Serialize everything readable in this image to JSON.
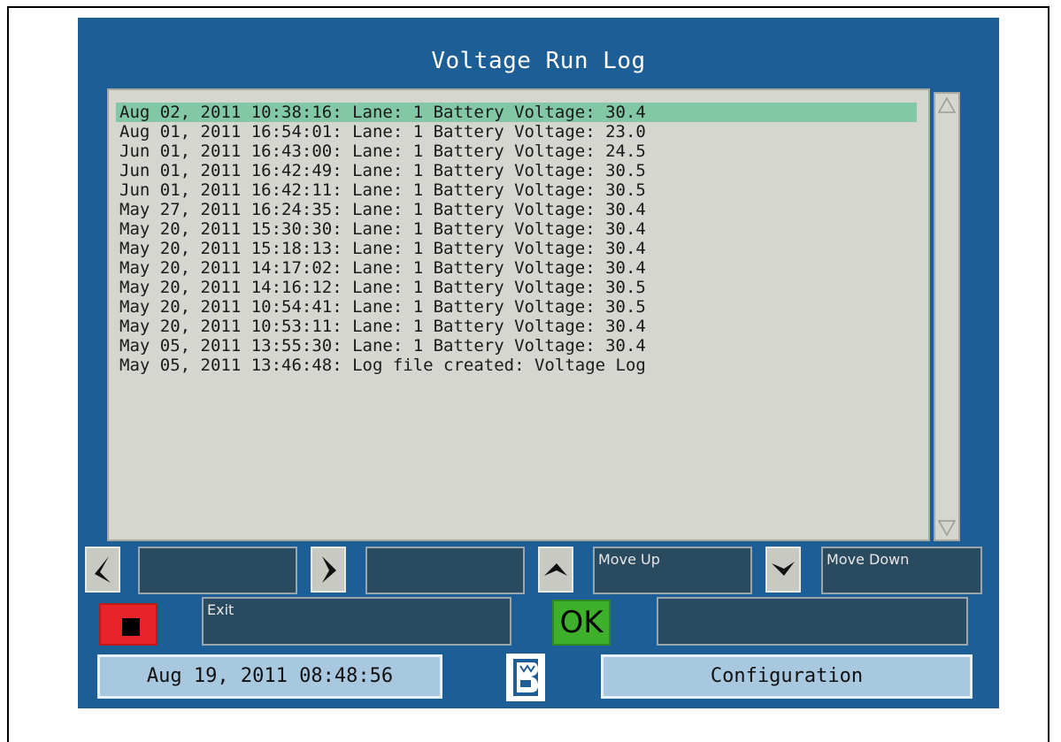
{
  "window": {
    "title": "Voltage Run Log"
  },
  "log": {
    "lines": [
      "Aug 02, 2011 10:38:16: Lane: 1 Battery Voltage: 30.4",
      "Aug 01, 2011 16:54:01: Lane: 1 Battery Voltage: 23.0",
      "Jun 01, 2011 16:43:00: Lane: 1 Battery Voltage: 24.5",
      "Jun 01, 2011 16:42:49: Lane: 1 Battery Voltage: 30.5",
      "Jun 01, 2011 16:42:11: Lane: 1 Battery Voltage: 30.5",
      "May 27, 2011 16:24:35: Lane: 1 Battery Voltage: 30.4",
      "May 20, 2011 15:30:30: Lane: 1 Battery Voltage: 30.4",
      "May 20, 2011 15:18:13: Lane: 1 Battery Voltage: 30.4",
      "May 20, 2011 14:17:02: Lane: 1 Battery Voltage: 30.4",
      "May 20, 2011 14:16:12: Lane: 1 Battery Voltage: 30.5",
      "May 20, 2011 10:54:41: Lane: 1 Battery Voltage: 30.5",
      "May 20, 2011 10:53:11: Lane: 1 Battery Voltage: 30.4",
      "May 05, 2011 13:55:30: Lane: 1 Battery Voltage: 30.4",
      "May 05, 2011 13:46:48: Log file created: Voltage Log"
    ],
    "selected_index": 0
  },
  "controls": {
    "left_label": "",
    "right_label": "",
    "move_up_label": "Move Up",
    "move_down_label": "Move Down",
    "exit_label": "Exit",
    "ok_label": "OK",
    "ok_field_label": ""
  },
  "footer": {
    "datetime": "Aug 19, 2011 08:48:56",
    "configuration_label": "Configuration"
  },
  "icons": {
    "left": "left-arrow-icon",
    "right": "right-arrow-icon",
    "up": "up-arrow-icon",
    "down": "down-arrow-icon",
    "stop": "stop-icon",
    "logo": "brand-logo-icon"
  },
  "colors": {
    "screen_bg": "#1e5e96",
    "selection": "#82c8a6",
    "stop": "#e8242a",
    "ok": "#3fb02c",
    "footer_button": "#a8c8e0"
  }
}
